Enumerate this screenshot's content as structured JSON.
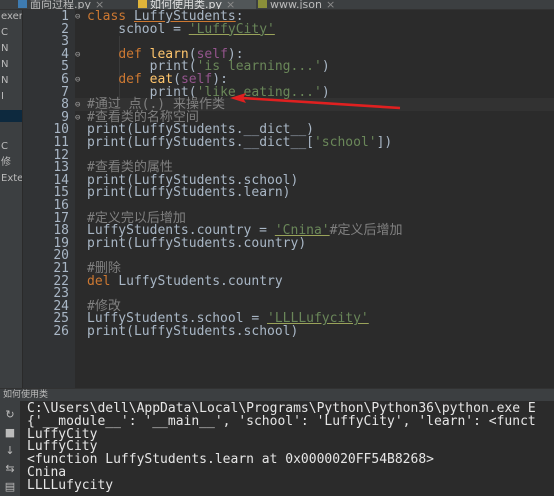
{
  "tabs": [
    {
      "label": "面向过程.py",
      "active": false
    },
    {
      "label": "如何使用类.py",
      "active": true
    },
    {
      "label": "www.json",
      "active": false
    }
  ],
  "project_panel": {
    "items": [
      "exer",
      "C",
      "N",
      "N",
      "N",
      "I",
      "C",
      "修",
      "Exte"
    ]
  },
  "editor": {
    "line_numbers": [
      "1",
      "2",
      "3",
      "4",
      "5",
      "6",
      "7",
      "8",
      "9",
      "10",
      "11",
      "12",
      "13",
      "14",
      "15",
      "16",
      "17",
      "18",
      "19",
      "20",
      "21",
      "22",
      "23",
      "24",
      "25",
      "26"
    ],
    "lines": [
      {
        "parts": [
          {
            "t": "class ",
            "c": "kw"
          },
          {
            "t": "LuffyStudents",
            "c": "cls"
          },
          {
            "t": ":",
            "c": ""
          }
        ]
      },
      {
        "parts": [
          {
            "t": "    school = ",
            "c": ""
          },
          {
            "t": "'LuffyCity'",
            "c": "strw"
          }
        ]
      },
      {
        "parts": []
      },
      {
        "parts": [
          {
            "t": "    ",
            "c": ""
          },
          {
            "t": "def ",
            "c": "kw"
          },
          {
            "t": "learn",
            "c": "fn"
          },
          {
            "t": "(",
            "c": ""
          },
          {
            "t": "self",
            "c": "self"
          },
          {
            "t": "):",
            "c": ""
          }
        ]
      },
      {
        "parts": [
          {
            "t": "        ",
            "c": ""
          },
          {
            "t": "print",
            "c": ""
          },
          {
            "t": "(",
            "c": ""
          },
          {
            "t": "'is learning...'",
            "c": "str"
          },
          {
            "t": ")",
            "c": ""
          }
        ]
      },
      {
        "parts": [
          {
            "t": "    ",
            "c": ""
          },
          {
            "t": "def ",
            "c": "kw"
          },
          {
            "t": "eat",
            "c": "fn"
          },
          {
            "t": "(",
            "c": ""
          },
          {
            "t": "self",
            "c": "self"
          },
          {
            "t": "):",
            "c": ""
          }
        ]
      },
      {
        "parts": [
          {
            "t": "        ",
            "c": ""
          },
          {
            "t": "print",
            "c": ""
          },
          {
            "t": "(",
            "c": ""
          },
          {
            "t": "'like eating...'",
            "c": "str"
          },
          {
            "t": ")",
            "c": ""
          }
        ]
      },
      {
        "parts": [
          {
            "t": "#通过 点(.) 来操作类",
            "c": "cm"
          }
        ]
      },
      {
        "parts": [
          {
            "t": "#查看类的名称空间",
            "c": "cm"
          }
        ]
      },
      {
        "parts": [
          {
            "t": "print",
            "c": ""
          },
          {
            "t": "(LuffyStudents.__dict__)",
            "c": ""
          }
        ]
      },
      {
        "parts": [
          {
            "t": "print",
            "c": ""
          },
          {
            "t": "(LuffyStudents.__dict__[",
            "c": ""
          },
          {
            "t": "'school'",
            "c": "str"
          },
          {
            "t": "])",
            "c": ""
          }
        ]
      },
      {
        "parts": []
      },
      {
        "parts": [
          {
            "t": "#查看类的属性",
            "c": "cm"
          }
        ]
      },
      {
        "parts": [
          {
            "t": "print",
            "c": ""
          },
          {
            "t": "(LuffyStudents.school)",
            "c": ""
          }
        ]
      },
      {
        "parts": [
          {
            "t": "print",
            "c": ""
          },
          {
            "t": "(LuffyStudents.learn)",
            "c": ""
          }
        ]
      },
      {
        "parts": []
      },
      {
        "parts": [
          {
            "t": "#定义完以后增加",
            "c": "cm"
          }
        ]
      },
      {
        "parts": [
          {
            "t": "LuffyStudents.country = ",
            "c": ""
          },
          {
            "t": "'Cnina'",
            "c": "strw"
          },
          {
            "t": "#定义后增加",
            "c": "cm"
          }
        ]
      },
      {
        "parts": [
          {
            "t": "print",
            "c": ""
          },
          {
            "t": "(LuffyStudents.country)",
            "c": ""
          }
        ]
      },
      {
        "parts": []
      },
      {
        "parts": [
          {
            "t": "#删除",
            "c": "cm"
          }
        ]
      },
      {
        "parts": [
          {
            "t": "del ",
            "c": "kw"
          },
          {
            "t": "LuffyStudents.country",
            "c": ""
          }
        ]
      },
      {
        "parts": []
      },
      {
        "parts": [
          {
            "t": "#修改",
            "c": "cm"
          }
        ]
      },
      {
        "parts": [
          {
            "t": "LuffyStudents.school = ",
            "c": ""
          },
          {
            "t": "'LLLLufycity'",
            "c": "strw"
          }
        ]
      },
      {
        "parts": [
          {
            "t": "print",
            "c": ""
          },
          {
            "t": "(LuffyStudents.school)",
            "c": ""
          }
        ]
      }
    ]
  },
  "run_panel": {
    "title": "如何使用类",
    "output": [
      "C:\\Users\\dell\\AppData\\Local\\Programs\\Python\\Python36\\python.exe E",
      "{'__module__': '__main__', 'school': 'LuffyCity', 'learn': <funct",
      "LuffyCity",
      "LuffyCity",
      "<function LuffyStudents.learn at 0x0000020FF54B8268>",
      "Cnina",
      "LLLLufycity"
    ]
  },
  "colors": {
    "annotation_arrow": "#e02020",
    "keyword": "#cc7832",
    "string": "#6a8759",
    "comment": "#808080",
    "function": "#ffc66d",
    "self": "#94558d"
  }
}
